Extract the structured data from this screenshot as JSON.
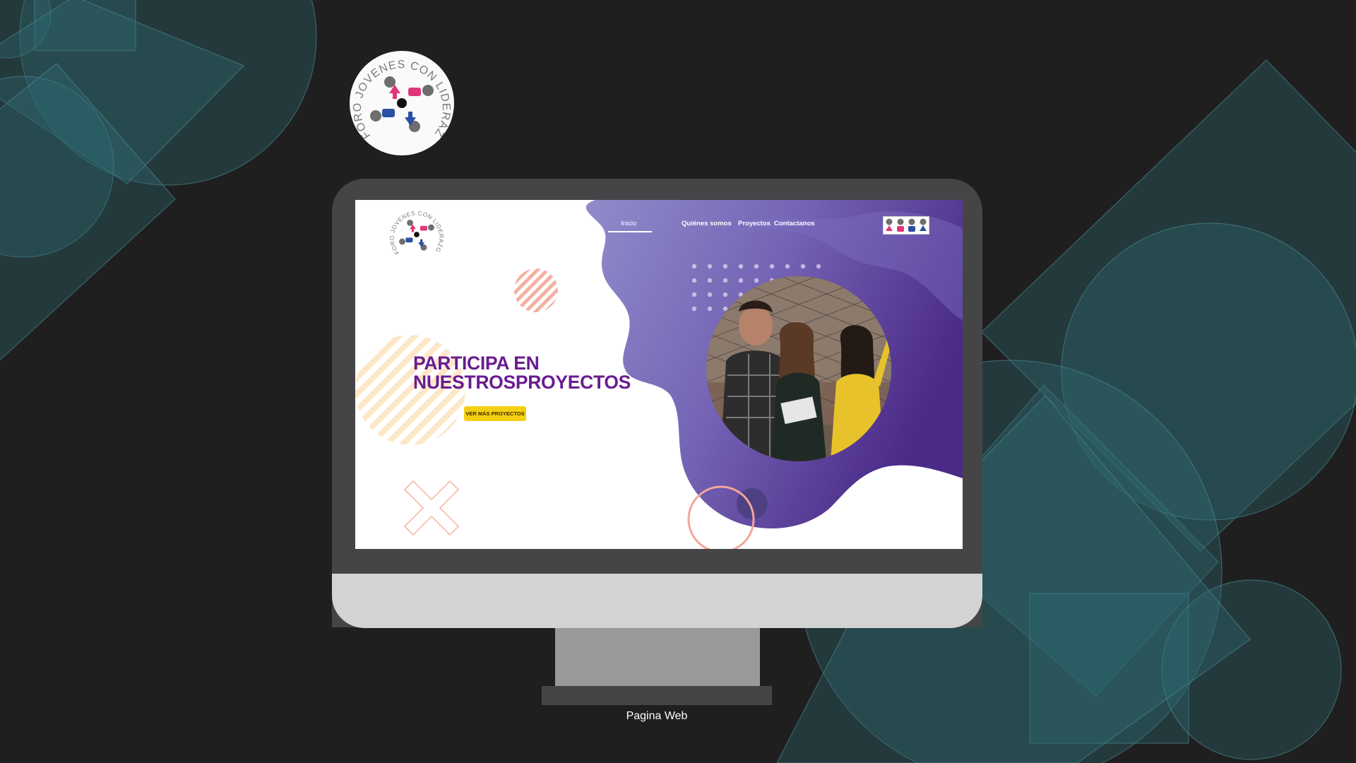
{
  "seal": {
    "text": "FORO JOVENES CON LIDERAZGO A.C.",
    "icon": "seal-logo-icon"
  },
  "screen": {
    "logo_text": "FORO JOVENES CON LIDERAZGO A.C.",
    "nav": {
      "items": [
        {
          "label": "Inicio",
          "active": true
        },
        {
          "label": "Quiénes somos",
          "active": false
        },
        {
          "label": "Proyectos",
          "active": false
        },
        {
          "label": "Contactanos",
          "active": false
        }
      ],
      "brand_icons": "people-figures-icon"
    },
    "hero": {
      "title_line1": "PARTICIPA EN",
      "title_line2": "NUESTROSPROYECTOS",
      "cta_label": "VER MÁS PROYECTOS"
    },
    "photo": "group-of-young-people-photo"
  },
  "caption": "Pagina Web",
  "colors": {
    "background": "#1f1f20",
    "teal_shapes": "#2f6b72",
    "purple": "#6a1c8f",
    "gradient_light": "#8c88c9",
    "gradient_dark": "#5a2f95",
    "cta_yellow": "#f5cf12",
    "accent_salmon": "#f3b1a1",
    "accent_peach": "#fde7c8"
  }
}
